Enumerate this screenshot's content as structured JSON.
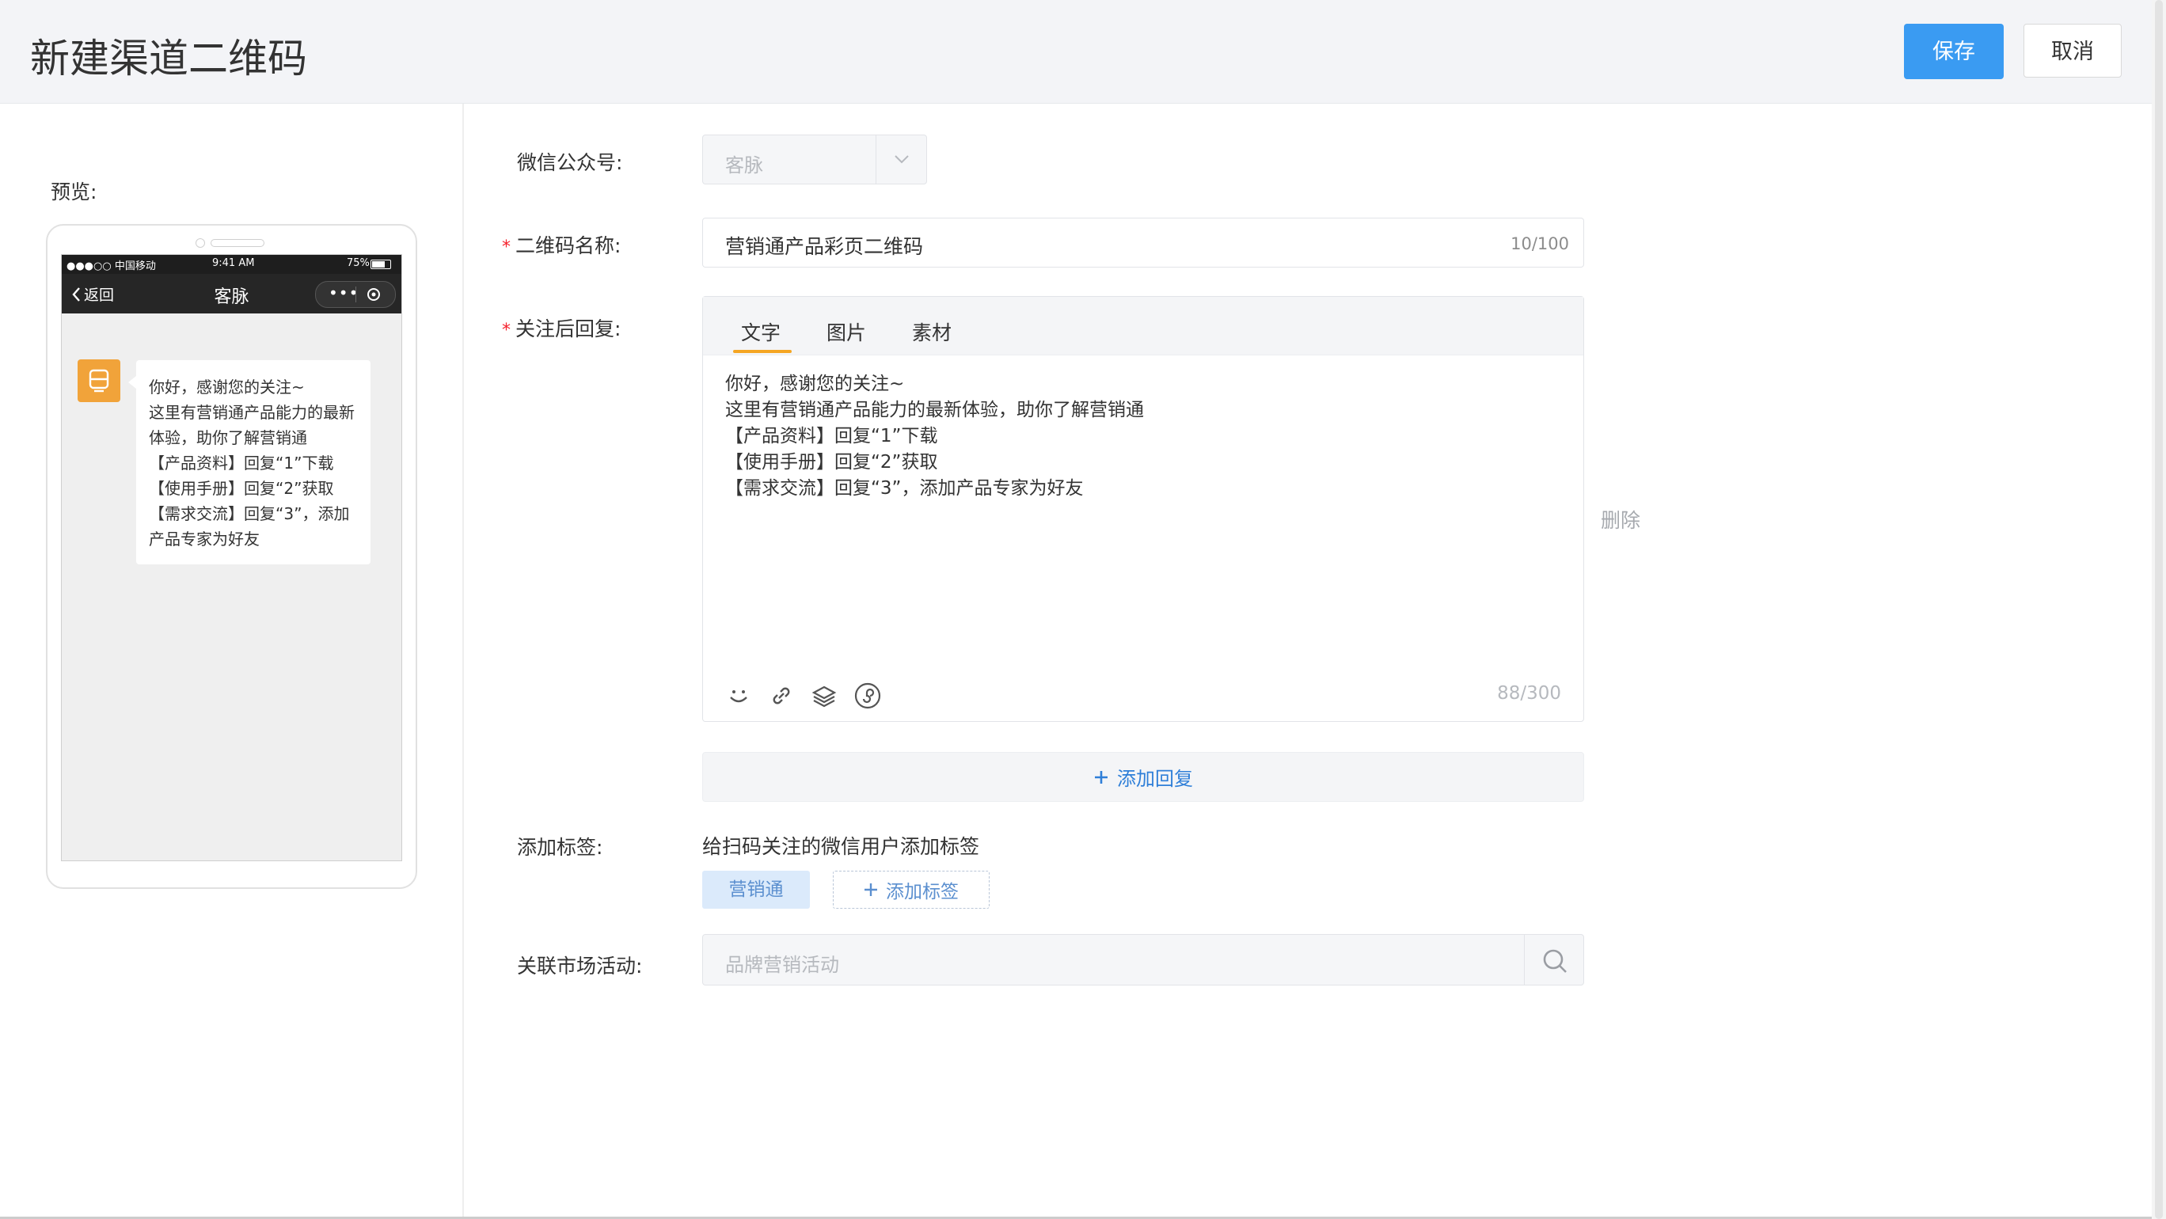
{
  "header": {
    "title": "新建渠道二维码",
    "save_label": "保存",
    "cancel_label": "取消"
  },
  "preview": {
    "label": "预览:",
    "status": {
      "carrier": "●●●○○ 中国移动",
      "time": "9:41 AM",
      "battery": "75%"
    },
    "nav": {
      "back": "返回",
      "title": "客脉"
    },
    "message": "你好，感谢您的关注~\n这里有营销通产品能力的最新体验，助你了解营销通\n【产品资料】回复“1”下载\n【使用手册】回复“2”获取\n【需求交流】回复“3”，添加产品专家为好友"
  },
  "form": {
    "wechat": {
      "label": "微信公众号:",
      "value": "客脉"
    },
    "qr_name": {
      "label": "二维码名称:",
      "value": "营销通产品彩页二维码",
      "count": "10/100"
    },
    "reply": {
      "label": "关注后回复:",
      "tabs": [
        {
          "label": "文字"
        },
        {
          "label": "图片"
        },
        {
          "label": "素材"
        }
      ],
      "text": "你好，感谢您的关注~\n这里有营销通产品能力的最新体验，助你了解营销通\n【产品资料】回复“1”下载\n【使用手册】回复“2”获取\n【需求交流】回复“3”，添加产品专家为好友",
      "count": "88/300",
      "delete_label": "删除",
      "add_label": "添加回复"
    },
    "tags": {
      "label": "添加标签:",
      "hint": "给扫码关注的微信用户添加标签",
      "items": [
        "营销通"
      ],
      "add_label": "添加标签"
    },
    "activity": {
      "label": "关联市场活动:",
      "placeholder": "品牌营销活动"
    }
  },
  "colors": {
    "primary": "#3a9bf2",
    "link": "#2f7fd8",
    "tab_indicator": "#f5a623",
    "avatar": "#f1a33a",
    "required": "#f5222d"
  }
}
